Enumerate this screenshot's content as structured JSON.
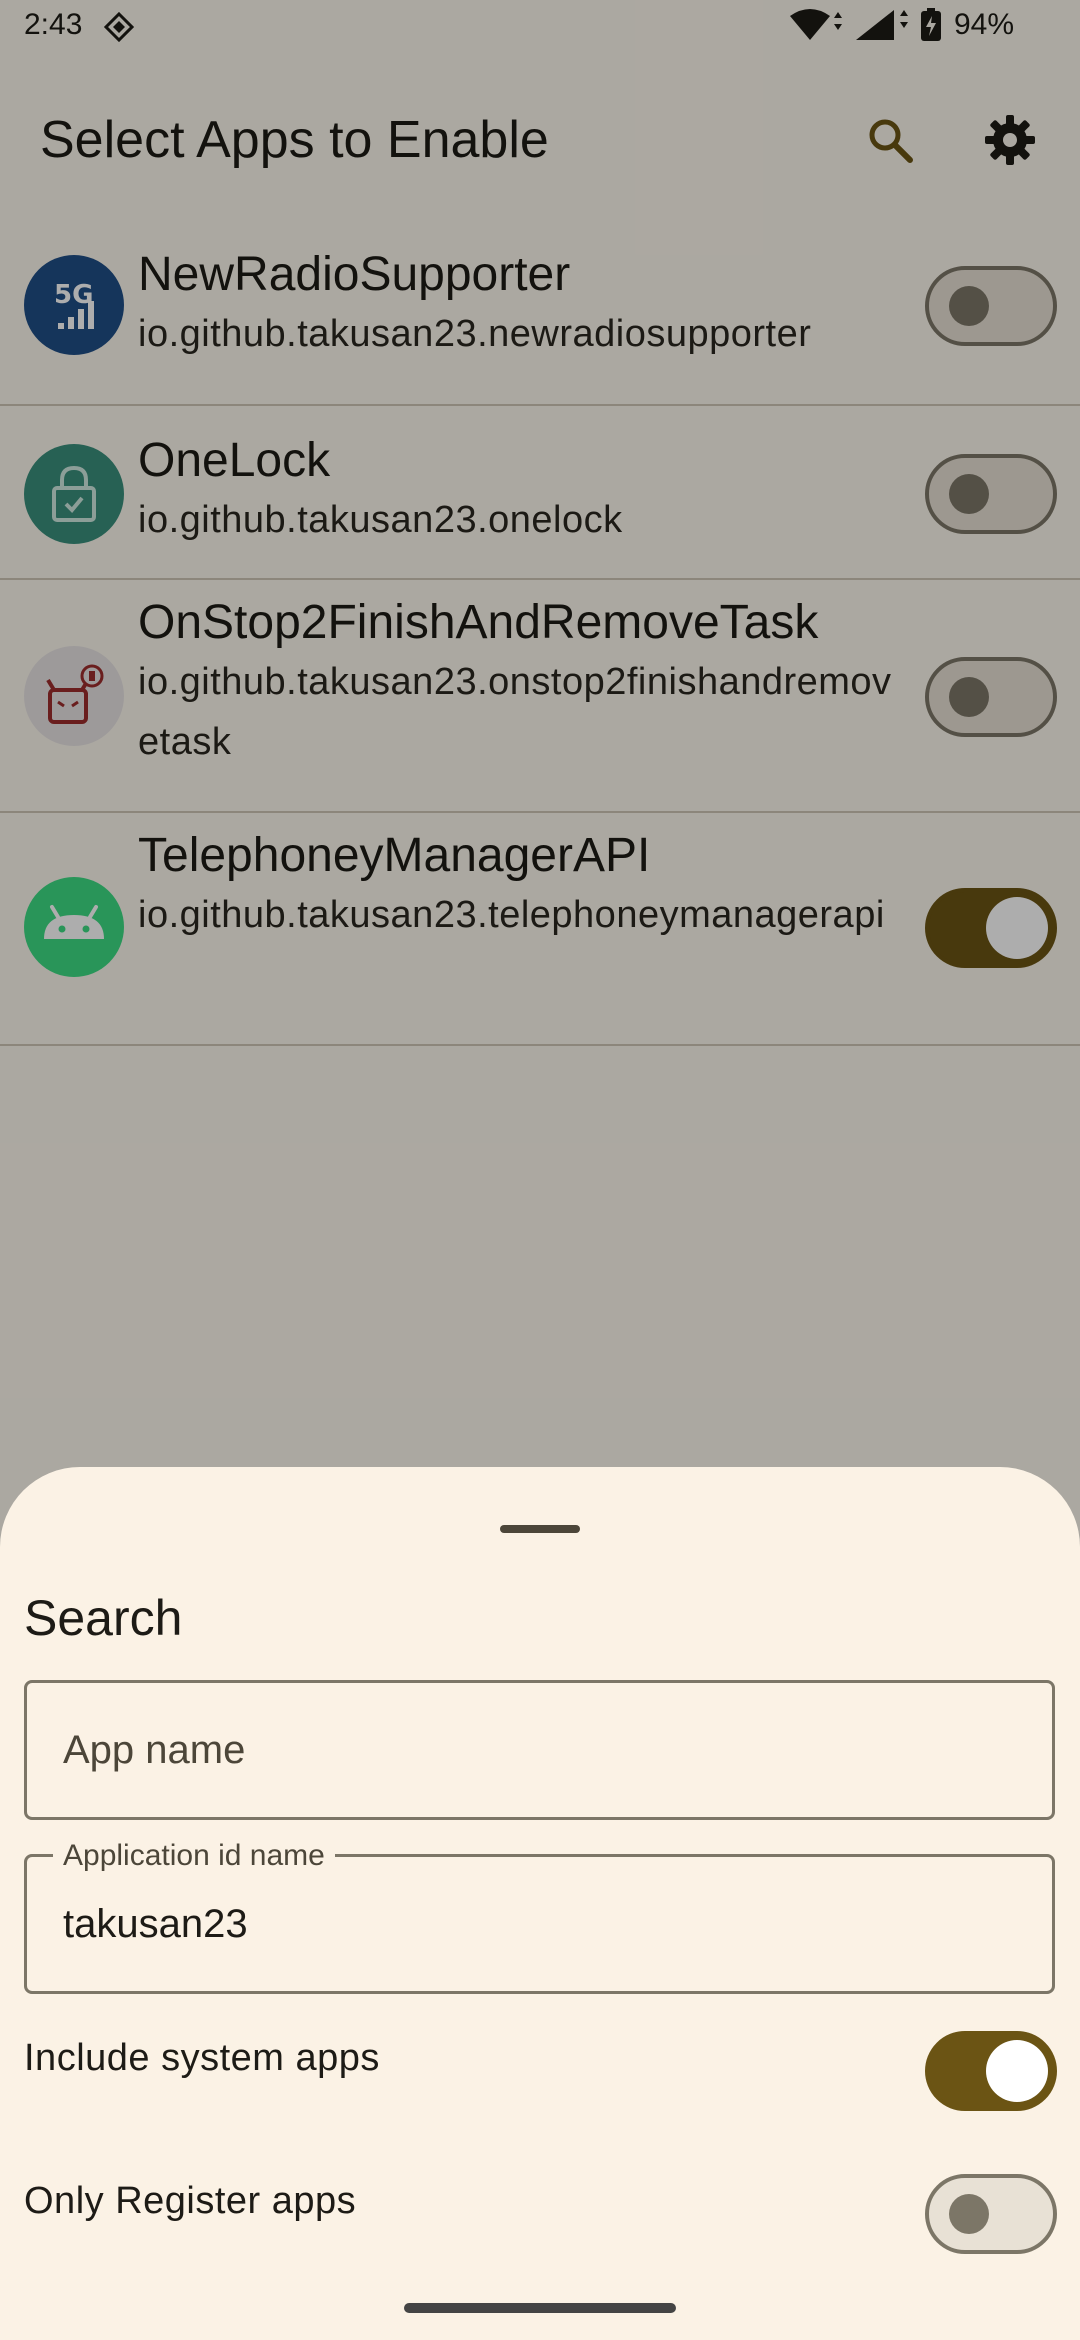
{
  "status_bar": {
    "time": "2:43",
    "battery": "94%"
  },
  "top_bar": {
    "title": "Select Apps to Enable",
    "search_icon": "search-icon",
    "settings_icon": "gear-icon"
  },
  "apps": [
    {
      "name": "NewRadioSupporter",
      "package": "io.github.takusan23.newradiosupporter",
      "icon_label": "5G",
      "enabled": false
    },
    {
      "name": "OneLock",
      "package": "io.github.takusan23.onelock",
      "enabled": false
    },
    {
      "name": "OnStop2FinishAndRemoveTask",
      "package": "io.github.takusan23.onstop2finishandremovetask",
      "enabled": false
    },
    {
      "name": "TelephoneyManagerAPI",
      "package": "io.github.takusan23.telephoneymanagerapi",
      "enabled": true
    }
  ],
  "search_sheet": {
    "title": "Search",
    "app_name_placeholder": "App name",
    "app_id_label": "Application id name",
    "app_id_value": "takusan23",
    "include_system_apps_label": "Include system apps",
    "include_system_apps": true,
    "only_register_apps_label": "Only Register apps",
    "only_register_apps": false
  },
  "colors": {
    "accent": "#6b5414",
    "sheet_bg": "#fbf2e5",
    "outline": "#7c7667"
  }
}
